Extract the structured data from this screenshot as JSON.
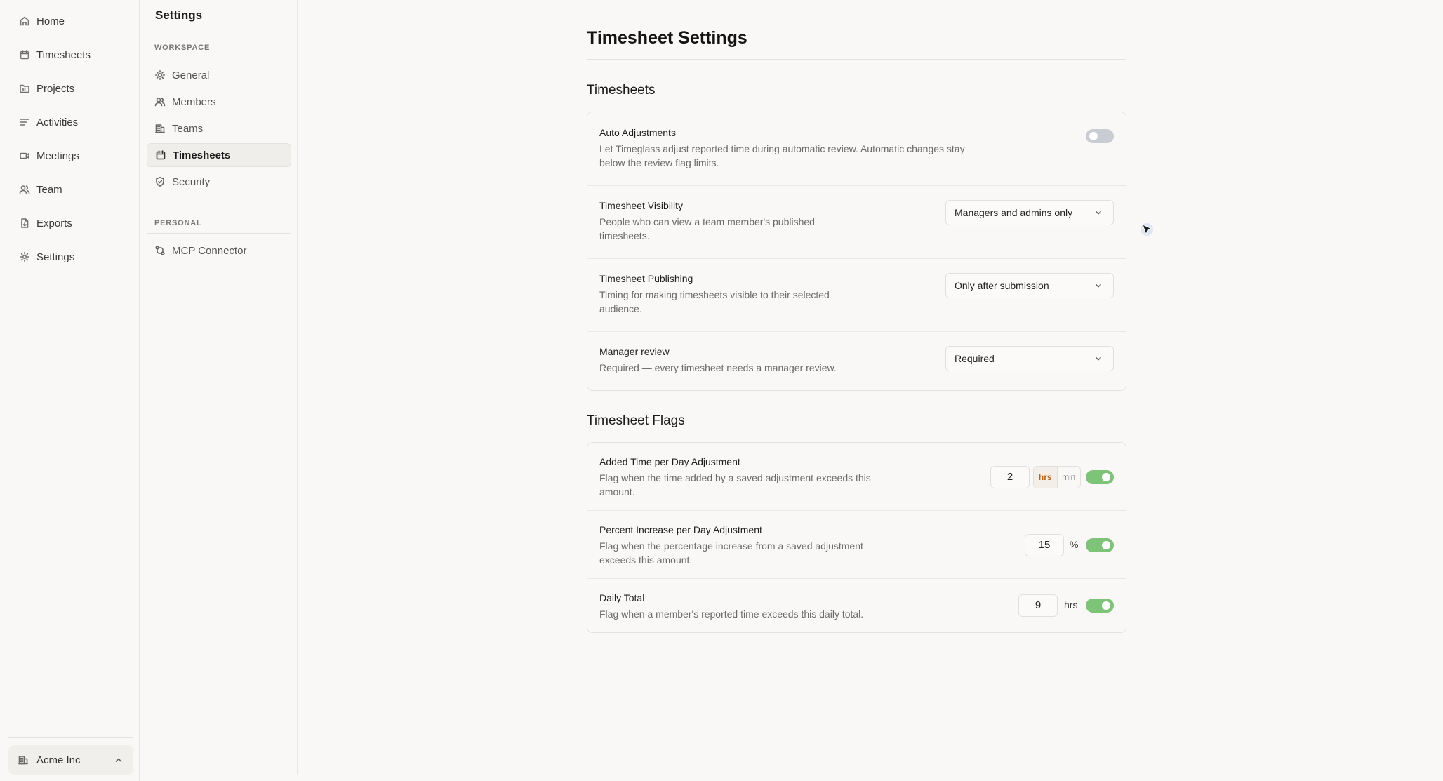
{
  "nav": {
    "items": [
      {
        "label": "Home",
        "icon": "home-icon"
      },
      {
        "label": "Timesheets",
        "icon": "calendar-icon"
      },
      {
        "label": "Projects",
        "icon": "folder-icon"
      },
      {
        "label": "Activities",
        "icon": "list-icon"
      },
      {
        "label": "Meetings",
        "icon": "video-icon"
      },
      {
        "label": "Team",
        "icon": "users-icon"
      },
      {
        "label": "Exports",
        "icon": "file-export-icon"
      },
      {
        "label": "Settings",
        "icon": "gear-icon"
      }
    ],
    "workspace": "Acme Inc"
  },
  "settings_nav": {
    "title": "Settings",
    "workspace_label": "WORKSPACE",
    "workspace_items": [
      {
        "label": "General"
      },
      {
        "label": "Members"
      },
      {
        "label": "Teams"
      },
      {
        "label": "Timesheets",
        "active": true
      },
      {
        "label": "Security"
      }
    ],
    "personal_label": "PERSONAL",
    "personal_items": [
      {
        "label": "MCP Connector"
      }
    ]
  },
  "page": {
    "title": "Timesheet Settings",
    "timesheets_section": {
      "title": "Timesheets",
      "auto_adjustments": {
        "label": "Auto Adjustments",
        "desc1": "Let Timeglass adjust reported time during automatic review. Automatic changes stay",
        "desc2": "below the review flag limits.",
        "enabled": false
      },
      "visibility": {
        "label": "Timesheet Visibility",
        "desc1": "People who can view a team member's published",
        "desc2": "timesheets.",
        "value": "Managers and admins only"
      },
      "publishing": {
        "label": "Timesheet Publishing",
        "desc1": "Timing for making timesheets visible to their selected",
        "desc2": "audience.",
        "value": "Only after submission"
      },
      "manager_review": {
        "label": "Manager review",
        "desc1": "Required — every timesheet needs a manager review.",
        "value": "Required"
      }
    },
    "flags_section": {
      "title": "Timesheet Flags",
      "added_time": {
        "label": "Added Time per Day Adjustment",
        "desc1": "Flag when the time added by a saved adjustment exceeds this",
        "desc2": "amount.",
        "value": "2",
        "unit_hrs": "hrs",
        "unit_min": "min",
        "selected_unit": "hrs",
        "enabled": true
      },
      "percent_increase": {
        "label": "Percent Increase per Day Adjustment",
        "desc1": "Flag when the percentage increase from a saved adjustment",
        "desc2": "exceeds this amount.",
        "value": "15",
        "unit": "%",
        "enabled": true
      },
      "daily_total": {
        "label": "Daily Total",
        "desc1": "Flag when a member's reported time exceeds this daily total.",
        "value": "9",
        "unit": "hrs",
        "enabled": true
      }
    }
  },
  "colors": {
    "toggle_on": "#7dc478",
    "toggle_off": "#c9ccd3",
    "selected_unit": "#b5651d"
  }
}
